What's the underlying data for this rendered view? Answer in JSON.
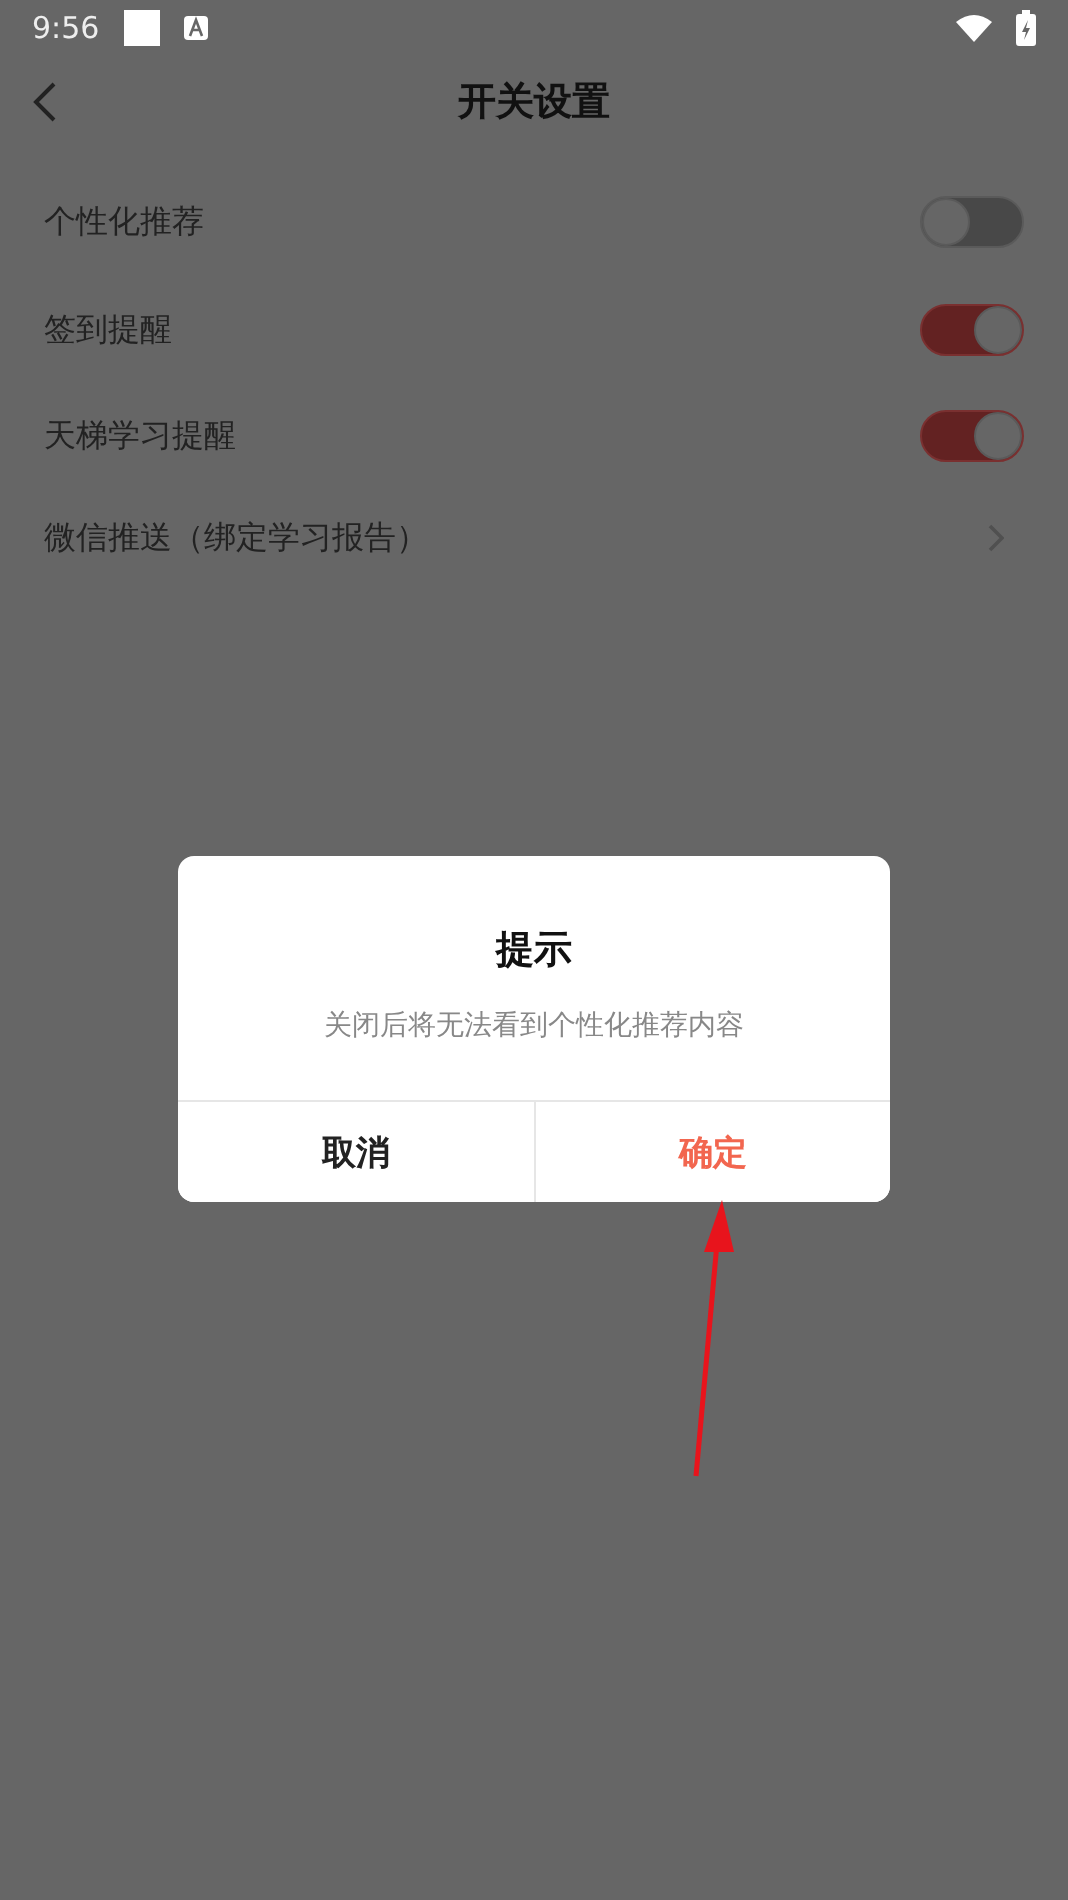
{
  "status_bar": {
    "time": "9:56"
  },
  "header": {
    "title": "开关设置"
  },
  "settings": [
    {
      "kind": "toggle",
      "label": "个性化推荐",
      "on": false
    },
    {
      "kind": "toggle",
      "label": "签到提醒",
      "on": true
    },
    {
      "kind": "toggle",
      "label": "天梯学习提醒",
      "on": true
    },
    {
      "kind": "link",
      "label": "微信推送（绑定学习报告）"
    }
  ],
  "dialog": {
    "title": "提示",
    "message": "关闭后将无法看到个性化推荐内容",
    "buttons": [
      {
        "label": "取消",
        "kind": "cancel"
      },
      {
        "label": "确定",
        "kind": "confirm"
      }
    ]
  }
}
